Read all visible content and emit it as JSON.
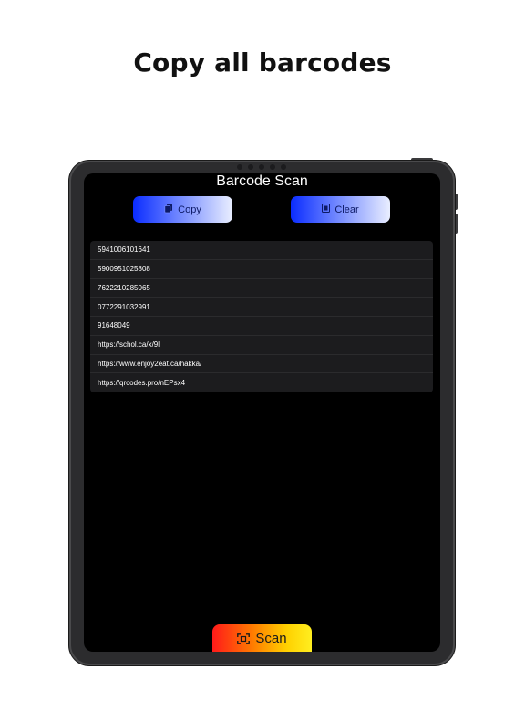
{
  "headline": "Copy all barcodes",
  "app": {
    "title": "Barcode Scan",
    "copy_label": "Copy",
    "clear_label": "Clear",
    "scan_label": "Scan"
  },
  "icons": {
    "copy": "copy-icon",
    "clear": "trash-icon",
    "scan": "scan-icon"
  },
  "barcodes": [
    "5941006101641",
    "5900951025808",
    "7622210285065",
    "0772291032991",
    "91648049",
    "https://schol.ca/x/9l",
    "https://www.enjoy2eat.ca/hakka/",
    "https://qrcodes.pro/nEPsx4"
  ],
  "colors": {
    "button_gradient": [
      "#0a2cff",
      "#e9eeff"
    ],
    "scan_gradient": [
      "#ff1a1a",
      "#ffee20"
    ],
    "screen_bg": "#000000",
    "list_bg": "#1c1c1e"
  }
}
